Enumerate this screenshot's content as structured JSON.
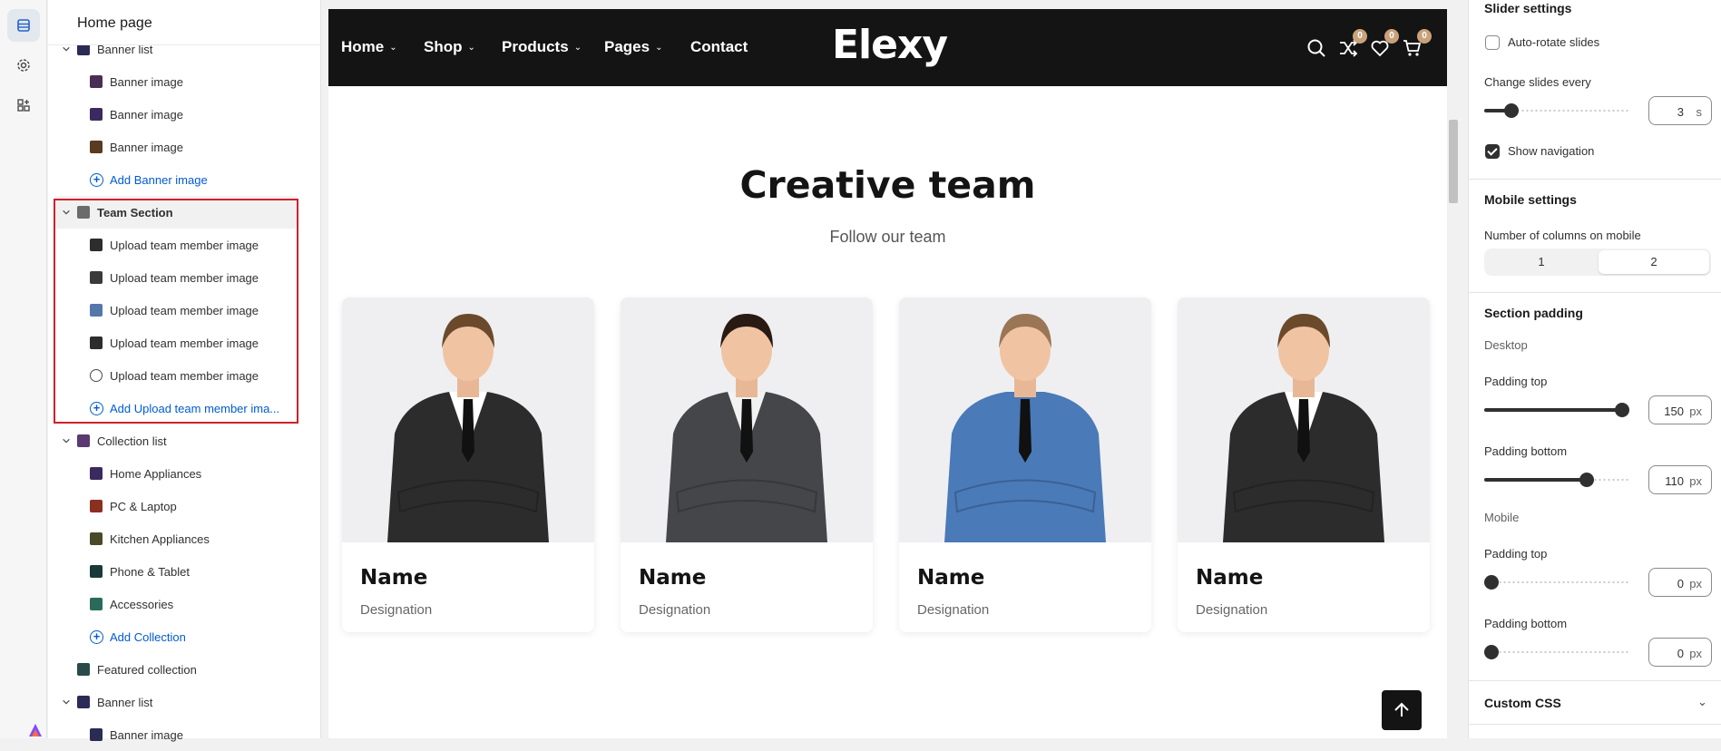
{
  "app": {
    "page_title": "Home page"
  },
  "rail": {
    "icons": [
      "sections-icon",
      "settings-gear-icon",
      "apps-icon"
    ]
  },
  "tree": {
    "items": [
      {
        "type": "group",
        "label": "Banner list",
        "thumb": "#2b2b55"
      },
      {
        "type": "block",
        "label": "Banner image",
        "thumb": "#4a2f55"
      },
      {
        "type": "block",
        "label": "Banner image",
        "thumb": "#3a2a60"
      },
      {
        "type": "block",
        "label": "Banner image",
        "thumb": "#5a3a20"
      },
      {
        "type": "add",
        "label": "Add Banner image"
      },
      {
        "type": "group",
        "label": "Team Section",
        "thumb": "#6b6b6b",
        "selected": true
      },
      {
        "type": "block",
        "label": "Upload team member image",
        "thumb": "#2d2d2d"
      },
      {
        "type": "block",
        "label": "Upload team member image",
        "thumb": "#3a3a3a"
      },
      {
        "type": "block",
        "label": "Upload team member image",
        "thumb": "#5577aa"
      },
      {
        "type": "block",
        "label": "Upload team member image",
        "thumb": "#2d2d2d"
      },
      {
        "type": "block",
        "label": "Upload team member image",
        "thumb": "placeholder"
      },
      {
        "type": "add",
        "label": "Add Upload team member ima..."
      },
      {
        "type": "group",
        "label": "Collection list",
        "thumb": "#5a3a70"
      },
      {
        "type": "block",
        "label": "Home Appliances",
        "thumb": "#3a2a60"
      },
      {
        "type": "block",
        "label": "PC & Laptop",
        "thumb": "#8a3020"
      },
      {
        "type": "block",
        "label": "Kitchen Appliances",
        "thumb": "#4a4a2a"
      },
      {
        "type": "block",
        "label": "Phone & Tablet",
        "thumb": "#1a3a3a"
      },
      {
        "type": "block",
        "label": "Accessories",
        "thumb": "#2a6a5a"
      },
      {
        "type": "add",
        "label": "Add Collection"
      },
      {
        "type": "section",
        "label": "Featured collection",
        "thumb": "#2a4a4a"
      },
      {
        "type": "group",
        "label": "Banner list",
        "thumb": "#2b2b55"
      },
      {
        "type": "block",
        "label": "Banner image",
        "thumb": "#2b2b55"
      }
    ]
  },
  "preview": {
    "nav": {
      "items": [
        "Home",
        "Shop",
        "Products",
        "Pages",
        "Contact"
      ],
      "brand": "Elexy",
      "badges": {
        "compare": "0",
        "wishlist": "0",
        "cart": "0"
      }
    },
    "team": {
      "title": "Creative team",
      "subtitle": "Follow our team",
      "members": [
        {
          "name": "Name",
          "designation": "Designation",
          "suit": "#2c2c2c",
          "hair": "#6b4a2b",
          "shirt": "#ffffff"
        },
        {
          "name": "Name",
          "designation": "Designation",
          "suit": "#45464a",
          "hair": "#2a1a14",
          "shirt": "#f2f2f2"
        },
        {
          "name": "Name",
          "designation": "Designation",
          "suit": "#4a7ab8",
          "hair": "#9a7556",
          "shirt": "#4a7ab8"
        },
        {
          "name": "Name",
          "designation": "Designation",
          "suit": "#2c2c2c",
          "hair": "#6b4a2b",
          "shirt": "#ffffff"
        }
      ]
    }
  },
  "settings": {
    "slider_heading": "Slider settings",
    "auto_rotate": {
      "label": "Auto-rotate slides",
      "checked": false
    },
    "change_every": {
      "label": "Change slides every",
      "value": "3",
      "unit": "s",
      "fraction": 0.15
    },
    "show_navigation": {
      "label": "Show navigation",
      "checked": true
    },
    "mobile_heading": "Mobile settings",
    "columns_mobile": {
      "label": "Number of columns on mobile",
      "options": [
        "1",
        "2"
      ],
      "selected": "2"
    },
    "padding_heading": "Section padding",
    "desktop_label": "Desktop",
    "desktop_top": {
      "label": "Padding top",
      "value": "150",
      "unit": "px",
      "fraction": 1.0
    },
    "desktop_bottom": {
      "label": "Padding bottom",
      "value": "110",
      "unit": "px",
      "fraction": 0.73
    },
    "mobile_label": "Mobile",
    "mobile_top": {
      "label": "Padding top",
      "value": "0",
      "unit": "px",
      "fraction": 0.0
    },
    "mobile_bottom": {
      "label": "Padding bottom",
      "value": "0",
      "unit": "px",
      "fraction": 0.0
    },
    "custom_css_label": "Custom CSS"
  }
}
